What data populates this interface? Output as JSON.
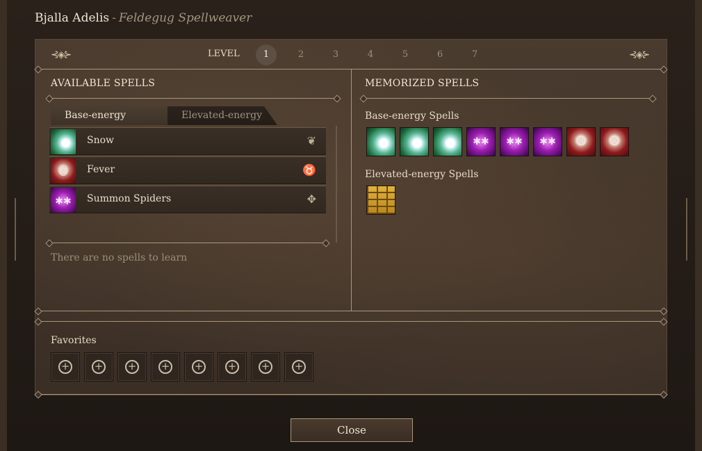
{
  "header": {
    "character_name": "Bjalla Adelis",
    "separator": "-",
    "class_name": "Feldegug Spellweaver"
  },
  "level_bar": {
    "label": "LEVEL",
    "levels": [
      "1",
      "2",
      "3",
      "4",
      "5",
      "6",
      "7"
    ],
    "selected": "1"
  },
  "available": {
    "title": "AVAILABLE SPELLS",
    "tabs": [
      {
        "label": "Base-energy",
        "active": true
      },
      {
        "label": "Elevated-energy",
        "active": false
      }
    ],
    "spells": [
      {
        "name": "Snow",
        "icon": "snow-spell-icon",
        "school_icon": "leaf-icon"
      },
      {
        "name": "Fever",
        "icon": "fever-spell-icon",
        "school_icon": "beast-skull-icon"
      },
      {
        "name": "Summon Spiders",
        "icon": "spiders-spell-icon",
        "school_icon": "paw-icon"
      }
    ],
    "empty_message": "There are no spells to learn"
  },
  "memorized": {
    "title": "MEMORIZED SPELLS",
    "base_title": "Base-energy Spells",
    "base_spells": [
      "snow",
      "snow",
      "snow",
      "spider",
      "spider",
      "spider",
      "fever",
      "fever"
    ],
    "elevated_title": "Elevated-energy Spells",
    "elevated_spells": [
      "wall"
    ]
  },
  "favorites": {
    "title": "Favorites",
    "slot_count": 8
  },
  "footer": {
    "close_label": "Close"
  }
}
